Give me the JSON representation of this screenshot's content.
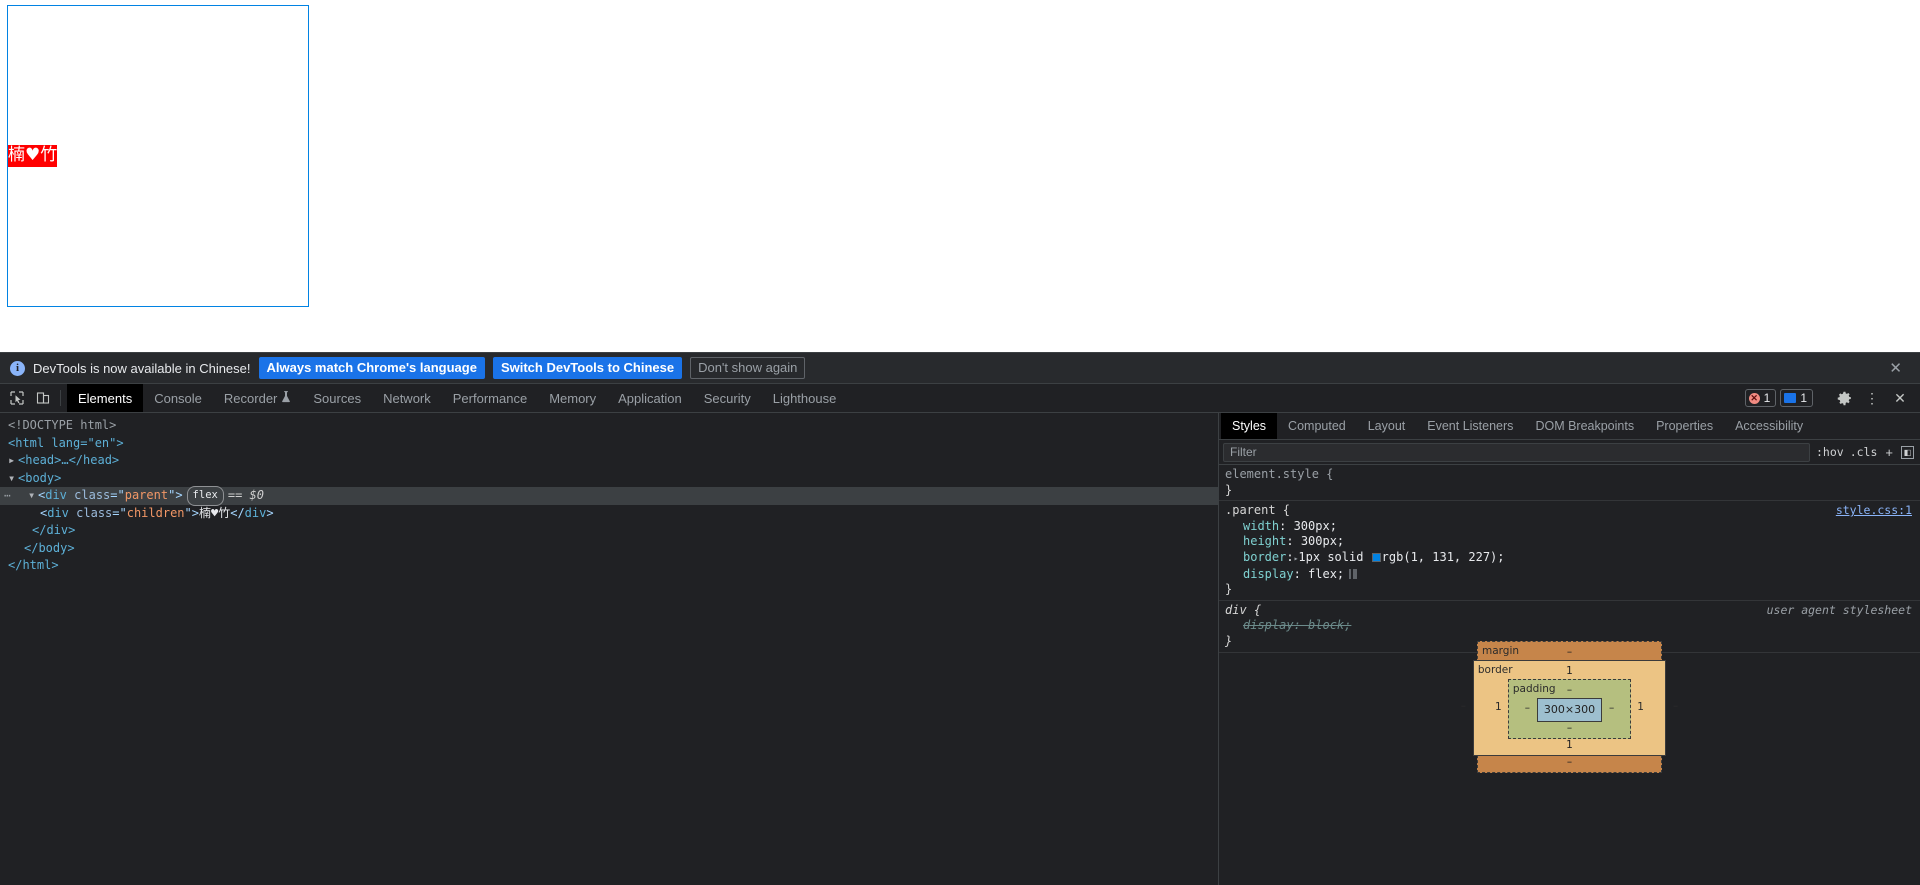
{
  "page": {
    "parent_class": "parent",
    "children_text": "楠♥竹",
    "children_bg": "#ff0000",
    "parent_border_color": "rgb(1, 131, 227)"
  },
  "notice": {
    "icon": "info-icon",
    "message": "DevTools is now available in Chinese!",
    "primary_button": "Always match Chrome's language",
    "secondary_button": "Switch DevTools to Chinese",
    "dismiss_button": "Don't show again",
    "close": "✕"
  },
  "toolbar": {
    "inspect_icon": "inspect-element-icon",
    "device_icon": "device-toolbar-icon",
    "tabs": [
      {
        "label": "Elements",
        "active": true
      },
      {
        "label": "Console",
        "active": false
      },
      {
        "label": "Recorder",
        "active": false,
        "icon": "flask-icon"
      },
      {
        "label": "Sources",
        "active": false
      },
      {
        "label": "Network",
        "active": false
      },
      {
        "label": "Performance",
        "active": false
      },
      {
        "label": "Memory",
        "active": false
      },
      {
        "label": "Application",
        "active": false
      },
      {
        "label": "Security",
        "active": false
      },
      {
        "label": "Lighthouse",
        "active": false
      }
    ],
    "error_count": "1",
    "message_count": "1",
    "settings_icon": "gear-icon",
    "more_icon": "kebab-menu-icon",
    "close_icon": "close-icon"
  },
  "dom": {
    "lines": [
      {
        "indent": 0,
        "text": "<!DOCTYPE html>"
      },
      {
        "indent": 0,
        "text": "<html lang=\"en\">"
      },
      {
        "indent": 1,
        "text": "<head>…</head>"
      },
      {
        "indent": 1,
        "text": "<body>"
      },
      {
        "indent": 2,
        "text": "<div class=\"parent\"> flex == $0",
        "selected": true
      },
      {
        "indent": 3,
        "text": "<div class=\"children\">楠♥竹</div>"
      },
      {
        "indent": 2,
        "text": "</div>"
      },
      {
        "indent": 1,
        "text": "</body>"
      },
      {
        "indent": 0,
        "text": "</html>"
      }
    ],
    "doctype": "<!DOCTYPE html>",
    "html_open": "<html lang=\"en\">",
    "head_collapsed": "<head>…</head>",
    "body_open": "<body>",
    "parent_tag": "div",
    "parent_attr_name": "class",
    "parent_attr_value": "parent",
    "flex_badge": "flex",
    "selection_marker": "== $0",
    "children_tag": "div",
    "children_attr_name": "class",
    "children_attr_value": "children",
    "children_text": "楠♥竹",
    "close_div": "</div>",
    "close_body": "</body>",
    "close_html": "</html>",
    "overflow_dots": "⋯"
  },
  "styles": {
    "tabs": [
      {
        "label": "Styles",
        "active": true
      },
      {
        "label": "Computed",
        "active": false
      },
      {
        "label": "Layout",
        "active": false
      },
      {
        "label": "Event Listeners",
        "active": false
      },
      {
        "label": "DOM Breakpoints",
        "active": false
      },
      {
        "label": "Properties",
        "active": false
      },
      {
        "label": "Accessibility",
        "active": false
      }
    ],
    "filter_placeholder": "Filter",
    "filter_value": "",
    "hov_button": ":hov",
    "cls_button": ".cls",
    "new_rule_button": "+",
    "sidebar_toggle": "◧",
    "rules": [
      {
        "selector": "element.style {",
        "close": "}",
        "origin": "",
        "declarations": []
      },
      {
        "selector": ".parent {",
        "close": "}",
        "origin": "style.css:1",
        "origin_kind": "link",
        "declarations": [
          {
            "name": "width",
            "value": "300px;"
          },
          {
            "name": "height",
            "value": "300px;"
          },
          {
            "name": "border",
            "value": "1px solid rgb(1, 131, 227);",
            "has_swatch": true,
            "has_triangle": true
          },
          {
            "name": "display",
            "value": "flex;",
            "has_flex_icon": true
          }
        ]
      },
      {
        "selector": "div {",
        "close": "}",
        "origin": "user agent stylesheet",
        "origin_kind": "ua",
        "italic": true,
        "declarations": [
          {
            "name": "display",
            "value": "block;",
            "struck": true
          }
        ]
      }
    ]
  },
  "box_model": {
    "margin_label": "margin",
    "margin_top": "–",
    "margin_right": "–",
    "margin_bottom": "–",
    "margin_left": "–",
    "border_label": "border",
    "border_top": "1",
    "border_right": "1",
    "border_bottom": "1",
    "border_left": "1",
    "padding_label": "padding",
    "padding_top": "–",
    "padding_right": "–",
    "padding_bottom": "–",
    "padding_left": "–",
    "content_size": "300×300"
  }
}
